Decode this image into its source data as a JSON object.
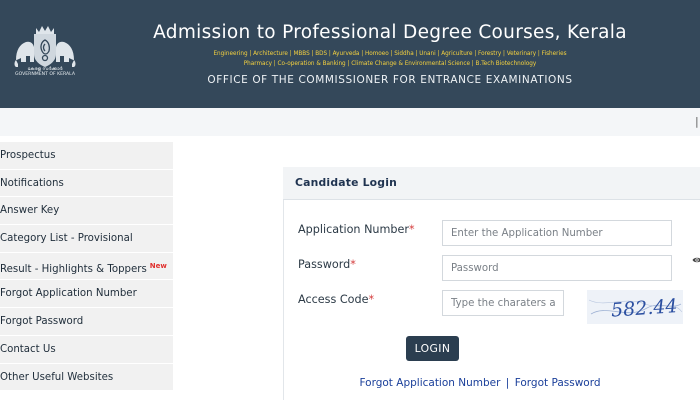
{
  "header": {
    "title": "Admission to Professional Degree Courses, Kerala",
    "subjects_line1": "Engineering | Architecture | MBBS | BDS | Ayurveda | Homoeo | Siddha | Unani | Agriculture | Forestry | Veterinary | Fisheries",
    "subjects_line2": "Pharmacy | Co-operation & Banking | Climate Change & Environmental Science | B.Tech Biotechnology",
    "office": "OFFICE OF THE COMMISSIONER FOR ENTRANCE EXAMINATIONS",
    "emblem_caption_line1": "കേരള സർക്കാർ",
    "emblem_caption_line2": "GOVERNMENT OF KERALA"
  },
  "sidebar": {
    "items": [
      {
        "label": "Prospectus"
      },
      {
        "label": "Notifications"
      },
      {
        "label": "Answer Key"
      },
      {
        "label": "Category List - Provisional"
      },
      {
        "label": "Result - Highlights & Toppers",
        "badge": "New"
      },
      {
        "label": "Forgot Application Number"
      },
      {
        "label": "Forgot Password"
      },
      {
        "label": "Contact Us"
      },
      {
        "label": "Other Useful Websites"
      }
    ]
  },
  "login": {
    "title": "Candidate Login",
    "application_label": "Application Number",
    "application_placeholder": "Enter the Application Number",
    "password_label": "Password",
    "password_placeholder": "Password",
    "access_label": "Access Code",
    "access_placeholder": "Type the charaters as in",
    "required_mark": "*",
    "captcha_text": "582.44",
    "button_label": "LOGIN",
    "forgot_app_link": "Forgot Application Number",
    "link_separator": "|",
    "forgot_password_link": "Forgot Password"
  },
  "colors": {
    "header_bg": "#34485a",
    "subject_text": "#f6d23f",
    "button_bg": "#2b3e50",
    "link": "#1a3f9a",
    "required": "#d43a3a",
    "new_badge": "#e0312f"
  },
  "icons": {
    "emblem": "kerala-emblem-icon",
    "password_toggle": "eye-icon"
  }
}
